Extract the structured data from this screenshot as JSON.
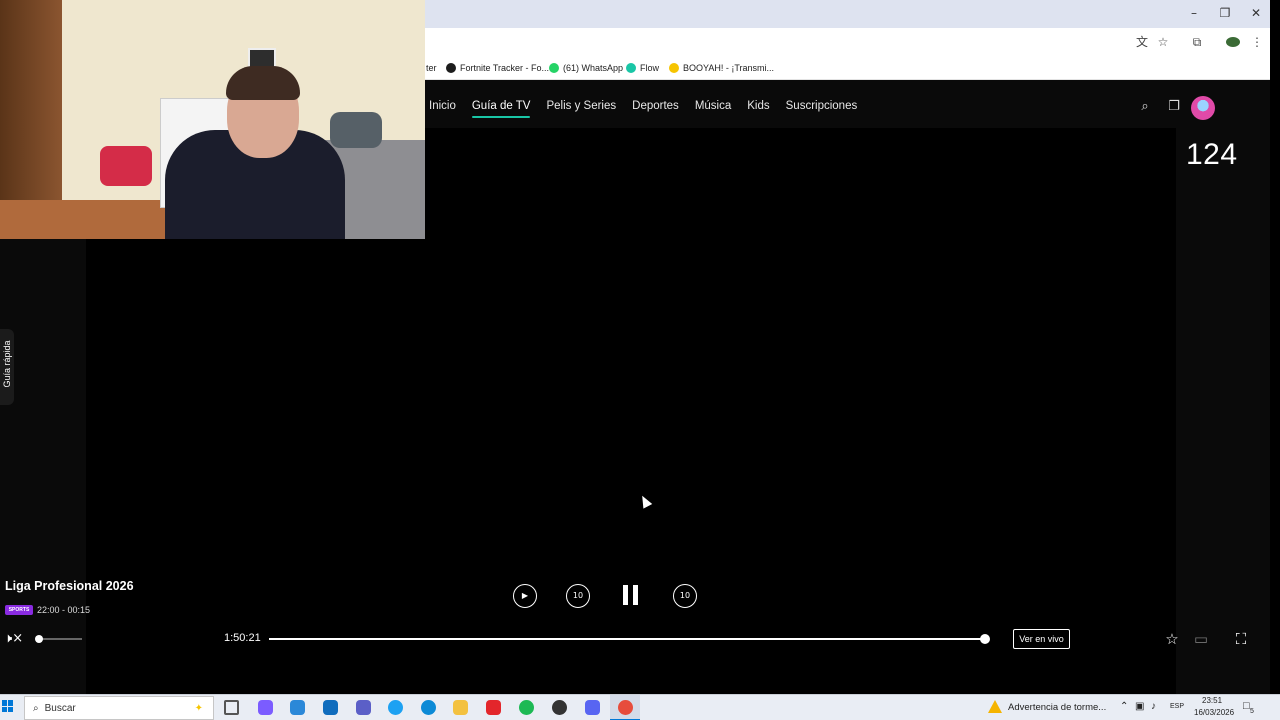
{
  "browser": {
    "window_controls": {
      "minimize": "–",
      "restore": "❐",
      "close": "✕"
    },
    "toolbar_icons": [
      "translate-icon",
      "star-icon",
      "extensions-icon",
      "profile-icon",
      "menu-icon"
    ],
    "bookmarks": [
      {
        "label": "ter",
        "color": ""
      },
      {
        "label": "Fortnite Tracker - Fo...",
        "color": "#1c1c1c"
      },
      {
        "label": "(61) WhatsApp",
        "color": "#25d366"
      },
      {
        "label": "Flow",
        "color": "#19c6a6"
      },
      {
        "label": "BOOYAH! - ¡Transmi...",
        "color": "#f6c400"
      }
    ]
  },
  "nav": {
    "links": [
      "Inicio",
      "Guía de TV",
      "Pelis y Series",
      "Deportes",
      "Música",
      "Kids",
      "Suscripciones"
    ],
    "active_index": 1,
    "accent_color": "#19c6a6"
  },
  "channel_number": "124",
  "quick_guide_label": "Guía rápida",
  "program": {
    "title": "Liga Profesional 2026",
    "channel_logo": "SPORTS",
    "schedule": "22:00 - 00:15"
  },
  "player": {
    "elapsed": "1:50:21",
    "progress": 0.995,
    "volume": 0.0,
    "live_button": "Ver en vivo",
    "replay_10": "10",
    "forward_10": "10"
  },
  "taskbar": {
    "search_placeholder": "Buscar",
    "weather_alert": "Advertencia de torme...",
    "language": "ESP",
    "time": "23:51",
    "date": "16/03/2026",
    "notifications": "5",
    "apps": [
      {
        "name": "task-view-icon",
        "color": "#555555"
      },
      {
        "name": "copilot-icon",
        "color": "#7b5cff"
      },
      {
        "name": "store-icon",
        "color": "#2b88d8"
      },
      {
        "name": "outlook-icon",
        "color": "#0f6cbd"
      },
      {
        "name": "teams-icon",
        "color": "#5b5fc7"
      },
      {
        "name": "edge-beta-icon",
        "color": "#1da1f2"
      },
      {
        "name": "edge-icon",
        "color": "#0c8ad6"
      },
      {
        "name": "explorer-icon",
        "color": "#f3c140"
      },
      {
        "name": "opera-icon",
        "color": "#e3262b"
      },
      {
        "name": "spotify-icon",
        "color": "#1db954"
      },
      {
        "name": "obs-icon",
        "color": "#333333"
      },
      {
        "name": "discord-icon",
        "color": "#5865f2"
      },
      {
        "name": "chrome-icon",
        "color": "#e74c3c"
      }
    ]
  }
}
